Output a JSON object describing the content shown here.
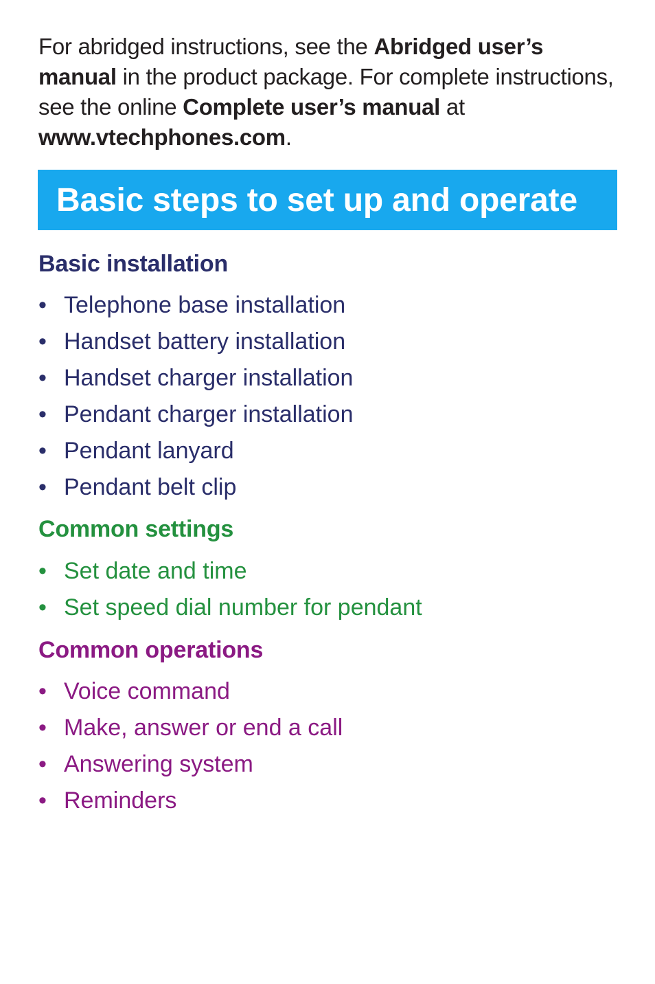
{
  "intro": {
    "t1": "For abridged instructions, see the ",
    "b1": "Abridged user’s manual",
    "t2": " in the product package. For complete instructions, see the online ",
    "b2": "Complete user’s manual",
    "t3": " at ",
    "b3": "www.vtechphones.com",
    "t4": "."
  },
  "banner": {
    "title": "Basic steps to set up and operate",
    "color": "#18a8ee"
  },
  "sections": [
    {
      "heading": "Basic installation",
      "color": "#2a2e6a",
      "items": [
        "Telephone base installation",
        "Handset battery installation",
        "Handset charger installation",
        "Pendant charger installation",
        "Pendant lanyard",
        "Pendant belt clip"
      ]
    },
    {
      "heading": "Common settings",
      "color": "#24913f",
      "items": [
        "Set date and time",
        "Set speed dial number for pendant"
      ]
    },
    {
      "heading": "Common operations",
      "color": "#8b1a83",
      "items": [
        "Voice command",
        "Make, answer or end a call",
        "Answering system",
        "Reminders"
      ]
    }
  ],
  "bullet_glyph": "•"
}
